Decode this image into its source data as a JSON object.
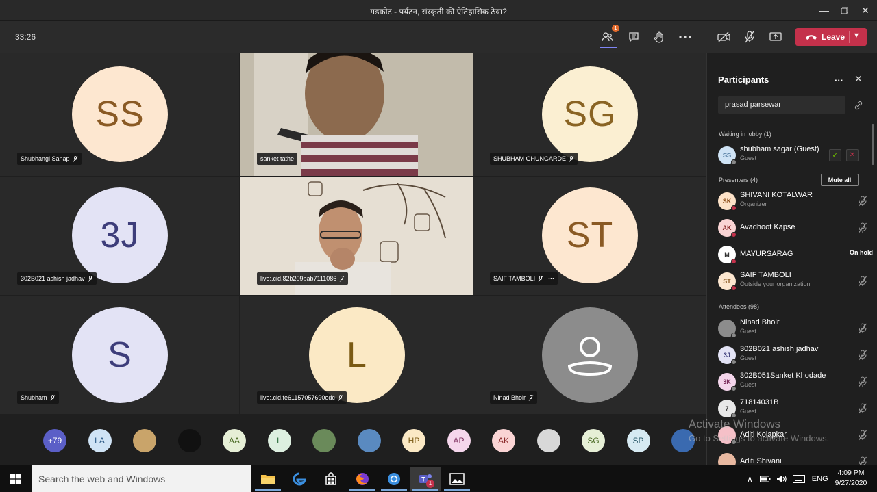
{
  "window": {
    "title": "गडकोट - पर्यटन, संस्कृती की ऐतिहासिक ठेवा?",
    "controls": [
      "minimize",
      "maximize",
      "close"
    ]
  },
  "toolbar": {
    "timer": "33:26",
    "participants_badge": "1",
    "leave_label": "Leave"
  },
  "tiles": [
    {
      "name": "Shubhangi Sanap",
      "initials": "SS",
      "bg": "#fde7d0",
      "fg": "#8a5a24"
    },
    {
      "name": "sanket tathe",
      "video": true
    },
    {
      "name": "SHUBHAM GHUNGARDE",
      "initials": "SG",
      "bg": "#fbefd2",
      "fg": "#8a6424"
    },
    {
      "name": "302B021 ashish jadhav",
      "initials": "3J",
      "bg": "#e3e3f5",
      "fg": "#3d3d7a"
    },
    {
      "name": "live:.cid.82b209bab7111086",
      "video": true
    },
    {
      "name": "SAIF TAMBOLI",
      "initials": "ST",
      "bg": "#fde7d0",
      "fg": "#8a5a24"
    },
    {
      "name": "Shubham",
      "initials": "S",
      "bg": "#e3e3f5",
      "fg": "#3d3d7a"
    },
    {
      "name": "live:.cid.fe61157057690edc",
      "initials": "L",
      "bg": "#fbe9c5",
      "fg": "#7a5a14"
    },
    {
      "name": "Ninad Bhoir",
      "initials": "",
      "bg": "#8c8c8c",
      "fg": "#ffffff"
    }
  ],
  "panel": {
    "title": "Participants",
    "search_value": "prasad parsewar",
    "waiting_label": "Waiting in lobby (1)",
    "waiting": [
      {
        "name": "shubham sagar (Guest)",
        "sub": "Guest",
        "initials": "SS",
        "bg": "#cfe3f5",
        "fg": "#2c5a86"
      }
    ],
    "presenters_label": "Presenters (4)",
    "mute_all": "Mute all",
    "presenters": [
      {
        "name": "SHIVANI KOTALWAR",
        "sub": "Organizer",
        "initials": "SK",
        "bg": "#fde2c8",
        "fg": "#8a4a14"
      },
      {
        "name": "Avadhoot Kapse",
        "sub": "",
        "initials": "AK",
        "bg": "#fad4d4",
        "fg": "#8a2a2a"
      },
      {
        "name": "MAYURSARAG",
        "sub": "",
        "initials": "M",
        "bg": "#ffffff",
        "fg": "#333333",
        "status": "On hold"
      },
      {
        "name": "SAIF TAMBOLI",
        "sub": "Outside your organization",
        "initials": "ST",
        "bg": "#fde7d0",
        "fg": "#8a5a24"
      }
    ],
    "attendees_label": "Attendees (98)",
    "attendees": [
      {
        "name": "Ninad Bhoir",
        "sub": "Guest",
        "initials": "",
        "bg": "#8c8c8c",
        "fg": "#ffffff"
      },
      {
        "name": "302B021 ashish jadhav",
        "sub": "Guest",
        "initials": "3J",
        "bg": "#e3e3f5",
        "fg": "#3d3d7a"
      },
      {
        "name": "302B051Sanket Khodade",
        "sub": "Guest",
        "initials": "3K",
        "bg": "#f5d6ec",
        "fg": "#7a2a5a"
      },
      {
        "name": "71814031B",
        "sub": "Guest",
        "initials": "7",
        "bg": "#e8e8e8",
        "fg": "#444444"
      },
      {
        "name": "Aditi Kolapkar",
        "sub": "",
        "initials": "",
        "bg": "#f5c0c8",
        "fg": "#7a2a3a"
      },
      {
        "name": "Aditi Shivani",
        "sub": "",
        "initials": "",
        "bg": "#e8b8a0",
        "fg": "#6a3a20"
      }
    ]
  },
  "strip": [
    {
      "label": "+79",
      "bg": "#5b5fc7",
      "fg": "#ffffff"
    },
    {
      "label": "LA",
      "bg": "#cfe3f5",
      "fg": "#2c5a86"
    },
    {
      "label": "",
      "bg": "#c9a46a",
      "fg": "#333"
    },
    {
      "label": "",
      "bg": "#111111",
      "fg": "#e04040"
    },
    {
      "label": "AA",
      "bg": "#e6efd6",
      "fg": "#4a6a24"
    },
    {
      "label": "L",
      "bg": "#ddefe0",
      "fg": "#2a6a3a"
    },
    {
      "label": "",
      "bg": "#6a8a5a",
      "fg": "#fff"
    },
    {
      "label": "",
      "bg": "#5a8ac0",
      "fg": "#fff"
    },
    {
      "label": "HP",
      "bg": "#fbe9c5",
      "fg": "#7a5a14"
    },
    {
      "label": "AP",
      "bg": "#f5d6ec",
      "fg": "#7a2a5a"
    },
    {
      "label": "AK",
      "bg": "#fad4d4",
      "fg": "#8a2a2a"
    },
    {
      "label": "",
      "bg": "#d8d8d8",
      "fg": "#333"
    },
    {
      "label": "SG",
      "bg": "#e6efd6",
      "fg": "#4a6a24"
    },
    {
      "label": "SP",
      "bg": "#d6eaf2",
      "fg": "#2a5a6a"
    },
    {
      "label": "",
      "bg": "#3a6ab0",
      "fg": "#fff"
    }
  ],
  "watermark": {
    "line1": "Activate Windows",
    "line2": "Go to Settings to activate Windows."
  },
  "taskbar": {
    "search_placeholder": "Search the web and Windows",
    "language": "ENG",
    "time": "4:09 PM",
    "date": "9/27/2020",
    "teams_badge": "1"
  }
}
